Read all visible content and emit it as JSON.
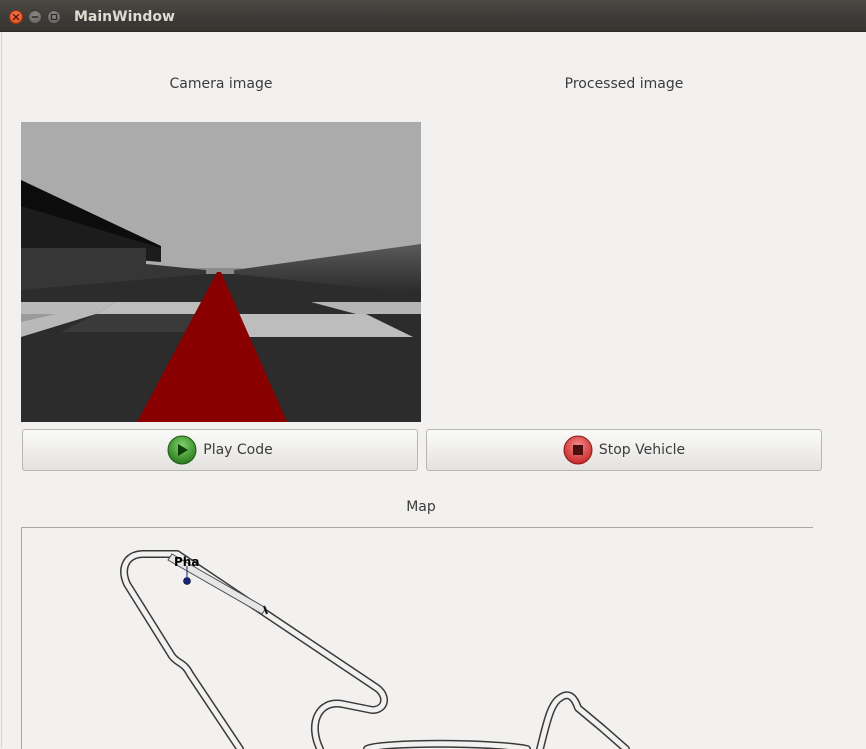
{
  "window": {
    "title": "MainWindow"
  },
  "labels": {
    "camera": "Camera image",
    "processed": "Processed image",
    "map": "Map"
  },
  "buttons": {
    "play": {
      "label": "Play Code",
      "icon": "play-icon",
      "color": "#2e8b22"
    },
    "stop": {
      "label": "Stop Vehicle",
      "icon": "stop-icon",
      "color": "#d32f2f"
    }
  },
  "map": {
    "vehicle_label": "Pha"
  },
  "colors": {
    "titlebar": "#3c3b37",
    "window_bg": "#f2f1f0",
    "close_button": "#df4b16",
    "road_line": "#ff0000"
  }
}
